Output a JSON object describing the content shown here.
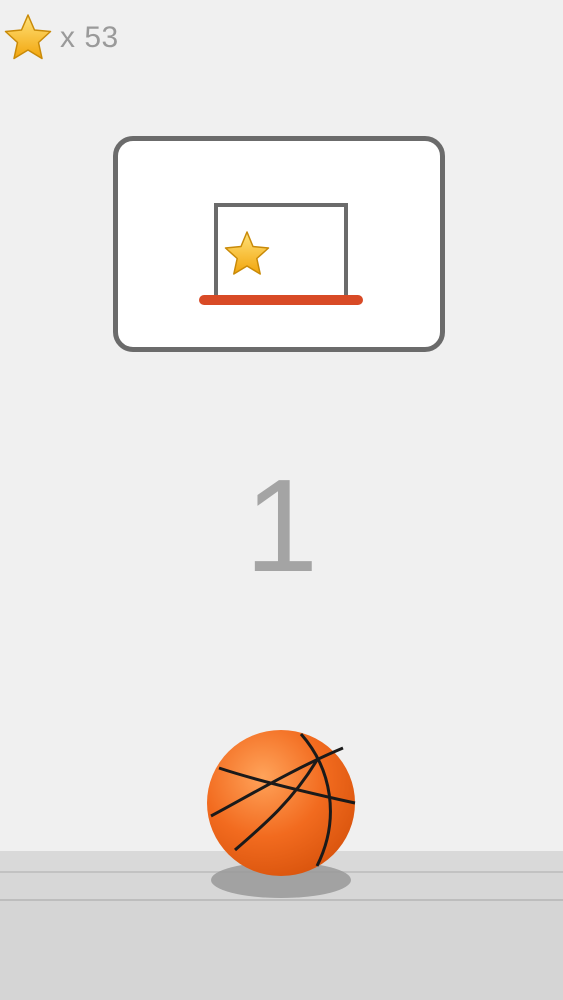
{
  "hud": {
    "star_count_text": "x 53",
    "star_icon": "star-icon"
  },
  "game": {
    "score": "1",
    "hoop": {
      "rim_color": "#d84a26",
      "bonus_item": "star-icon"
    },
    "ball": "basketball-icon"
  },
  "colors": {
    "background": "#f0f0f0",
    "backboard_border": "#6b6b6b",
    "rim": "#d84a26",
    "ball": "#f26b1f",
    "star": "#f5b820"
  }
}
